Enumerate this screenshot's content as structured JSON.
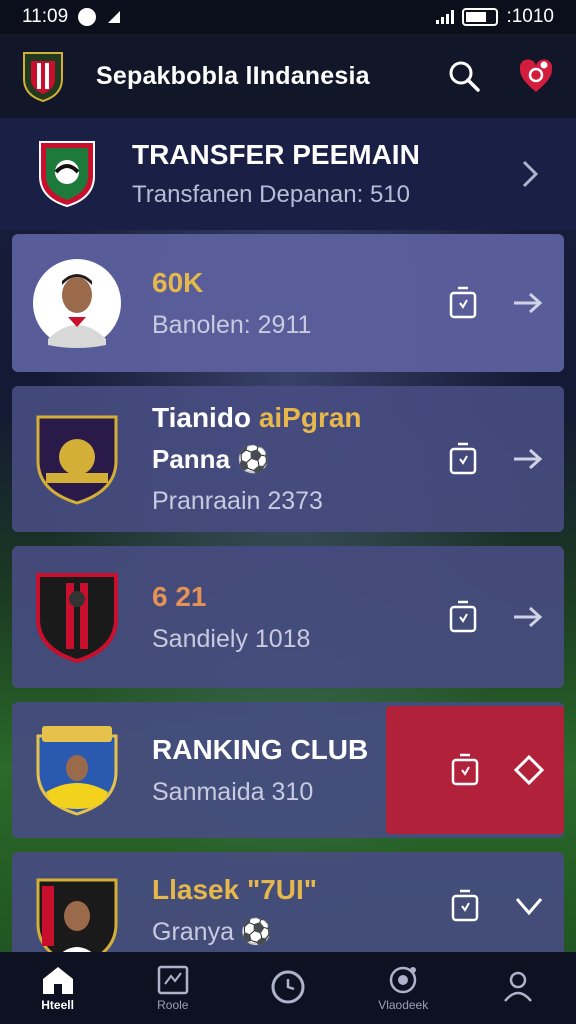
{
  "status": {
    "time": "11:09",
    "right_text": ":1010"
  },
  "app": {
    "title": "Sepakbobla lIndanesia"
  },
  "section": {
    "title": "TRANSFER PEEMAIN",
    "subtitle": "Transfanen Depanan: 510"
  },
  "cards": [
    {
      "title": "60K",
      "subtitle": "Banolen: 2911"
    },
    {
      "title_main": "Tianido ",
      "title_accent": "aiPgran",
      "line2": "Panna ⚽",
      "subtitle": "Pranraain 2373"
    },
    {
      "title": "6 21",
      "subtitle": "Sandiely 1018"
    },
    {
      "title": "RANKING CLUB",
      "subtitle": "Sanmaida 310"
    },
    {
      "title": "Llasek \"7UI\"",
      "subtitle": "Granya ⚽"
    }
  ],
  "nav": [
    {
      "label": "Hteell",
      "icon": "home-icon"
    },
    {
      "label": "Roole",
      "icon": "tactics-board-icon"
    },
    {
      "label": "",
      "icon": "clock-icon"
    },
    {
      "label": "Vlaodeek",
      "icon": "trophy-icon"
    },
    {
      "label": "",
      "icon": "profile-icon"
    }
  ],
  "colors": {
    "accent_gold": "#e6b84c",
    "highlight_red": "#b2213a",
    "card_bg": "#464c80"
  }
}
